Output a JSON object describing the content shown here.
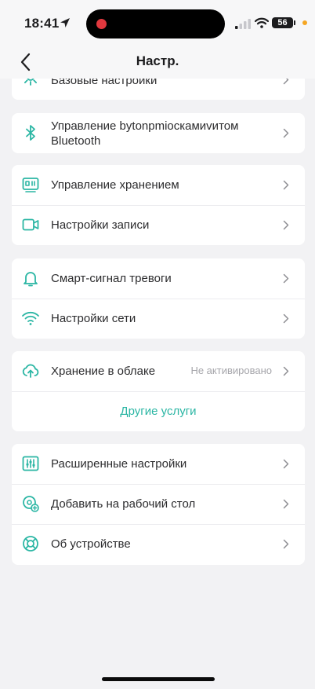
{
  "status_bar": {
    "time": "18:41",
    "battery": "56",
    "icons": [
      "location-arrow-icon",
      "recording-dot-icon",
      "cellular-signal-icon",
      "wifi-icon",
      "battery-icon",
      "orange-privacy-dot-icon"
    ]
  },
  "header": {
    "title": "Настр.",
    "back_icon": "chevron-left-icon"
  },
  "accent_color": "#2bb6a4",
  "groups": [
    {
      "items": [
        {
          "label": "Базовые настройки",
          "icon": "gear-icon"
        }
      ]
    },
    {
      "items": [
        {
          "label": "Управление bytonpmioскамиvитом Bluetooth",
          "icon": "bluetooth-icon"
        }
      ]
    },
    {
      "items": [
        {
          "label": "Управление хранением",
          "icon": "storage-icon"
        },
        {
          "label": "Настройки записи",
          "icon": "video-camera-icon"
        }
      ]
    },
    {
      "items": [
        {
          "label": "Смарт-сигнал тревоги",
          "icon": "bell-icon"
        },
        {
          "label": "Настройки сети",
          "icon": "wifi-icon"
        }
      ]
    },
    {
      "items": [
        {
          "label": "Хранение в облаке",
          "status": "Не активировано",
          "icon": "cloud-upload-icon"
        }
      ],
      "link": "Другие услуги"
    },
    {
      "items": [
        {
          "label": "Расширенные настройки",
          "icon": "sliders-icon"
        },
        {
          "label": "Добавить на рабочий стол",
          "icon": "add-to-home-icon"
        },
        {
          "label": "Об устройстве",
          "icon": "lifebuoy-icon"
        }
      ]
    }
  ]
}
